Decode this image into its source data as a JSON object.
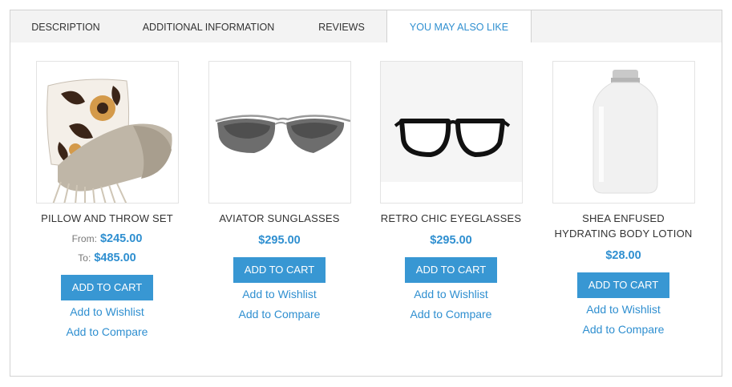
{
  "tabs": [
    {
      "label": "DESCRIPTION"
    },
    {
      "label": "ADDITIONAL INFORMATION"
    },
    {
      "label": "REVIEWS"
    },
    {
      "label": "YOU MAY ALSO LIKE",
      "active": true
    }
  ],
  "products": [
    {
      "name": "PILLOW AND THROW SET",
      "image_icon": "pillow-throw-image",
      "from_label": "From:",
      "from_price": "$245.00",
      "to_label": "To:",
      "to_price": "$485.00",
      "add_to_cart": "ADD TO CART",
      "wishlist": "Add to Wishlist",
      "compare": "Add to Compare"
    },
    {
      "name": "AVIATOR SUNGLASSES",
      "image_icon": "sunglasses-image",
      "price": "$295.00",
      "add_to_cart": "ADD TO CART",
      "wishlist": "Add to Wishlist",
      "compare": "Add to Compare"
    },
    {
      "name": "RETRO CHIC EYEGLASSES",
      "image_icon": "eyeglasses-image",
      "price": "$295.00",
      "add_to_cart": "ADD TO CART",
      "wishlist": "Add to Wishlist",
      "compare": "Add to Compare"
    },
    {
      "name_line1": "SHEA ENFUSED",
      "name_line2": "HYDRATING BODY LOTION",
      "image_icon": "lotion-bottle-image",
      "price": "$28.00",
      "add_to_cart": "ADD TO CART",
      "wishlist": "Add to Wishlist",
      "compare": "Add to Compare"
    }
  ],
  "colors": {
    "accent": "#2f8fd0",
    "button": "#3897d3",
    "tab_bg": "#f3f3f3",
    "border": "#d2d2d2"
  }
}
